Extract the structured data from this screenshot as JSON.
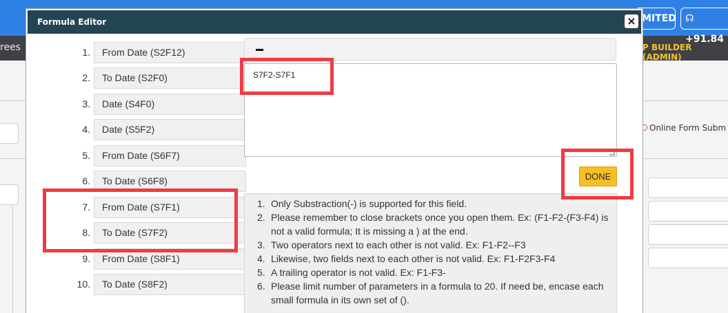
{
  "background": {
    "left_label": "rees",
    "pill_one": "MITED",
    "pill_two": "+91.84",
    "builder_label": "P BUILDER (ADMIN)",
    "online_form": "Online Form Subm"
  },
  "modal": {
    "title": "Formula Editor",
    "close_label": "×",
    "fields": [
      {
        "num": "1.",
        "label": "From Date (S2F12)"
      },
      {
        "num": "2.",
        "label": "To Date (S2F0)"
      },
      {
        "num": "3.",
        "label": "Date (S4F0)"
      },
      {
        "num": "4.",
        "label": "Date (S5F2)"
      },
      {
        "num": "5.",
        "label": "From Date (S6F7)"
      },
      {
        "num": "6.",
        "label": "To Date (S6F8)"
      },
      {
        "num": "7.",
        "label": "From Date (S7F1)"
      },
      {
        "num": "8.",
        "label": "To Date (S7F2)"
      },
      {
        "num": "9.",
        "label": "From Date (S8F1)"
      },
      {
        "num": "10.",
        "label": "To Date (S8F2)"
      }
    ],
    "operator_icon": "minus-icon",
    "formula_value": "S7F2-S7F1",
    "done_label": "DONE",
    "rules": [
      {
        "num": "1.",
        "text": "Only Substraction(-) is supported for this field."
      },
      {
        "num": "2.",
        "text": "Please remember to close brackets once you open them. Ex: (F1-F2-(F3-F4) is not a valid formula; It is missing a ) at the end."
      },
      {
        "num": "3.",
        "text": "Two operators next to each other is not valid. Ex: F1-F2--F3"
      },
      {
        "num": "4.",
        "text": "Likewise, two fields next to each other is not valid. Ex: F1-F2F3-F4"
      },
      {
        "num": "5.",
        "text": "A trailing operator is not valid. Ex: F1-F3-"
      },
      {
        "num": "6.",
        "text": "Please limit number of parameters in a formula to 20. If need be, encase each small formula in its own set of ()."
      }
    ]
  },
  "colors": {
    "header": "#234553",
    "done": "#f6bf26",
    "highlight": "#ef3b43",
    "topbar": "#2f80e4"
  }
}
